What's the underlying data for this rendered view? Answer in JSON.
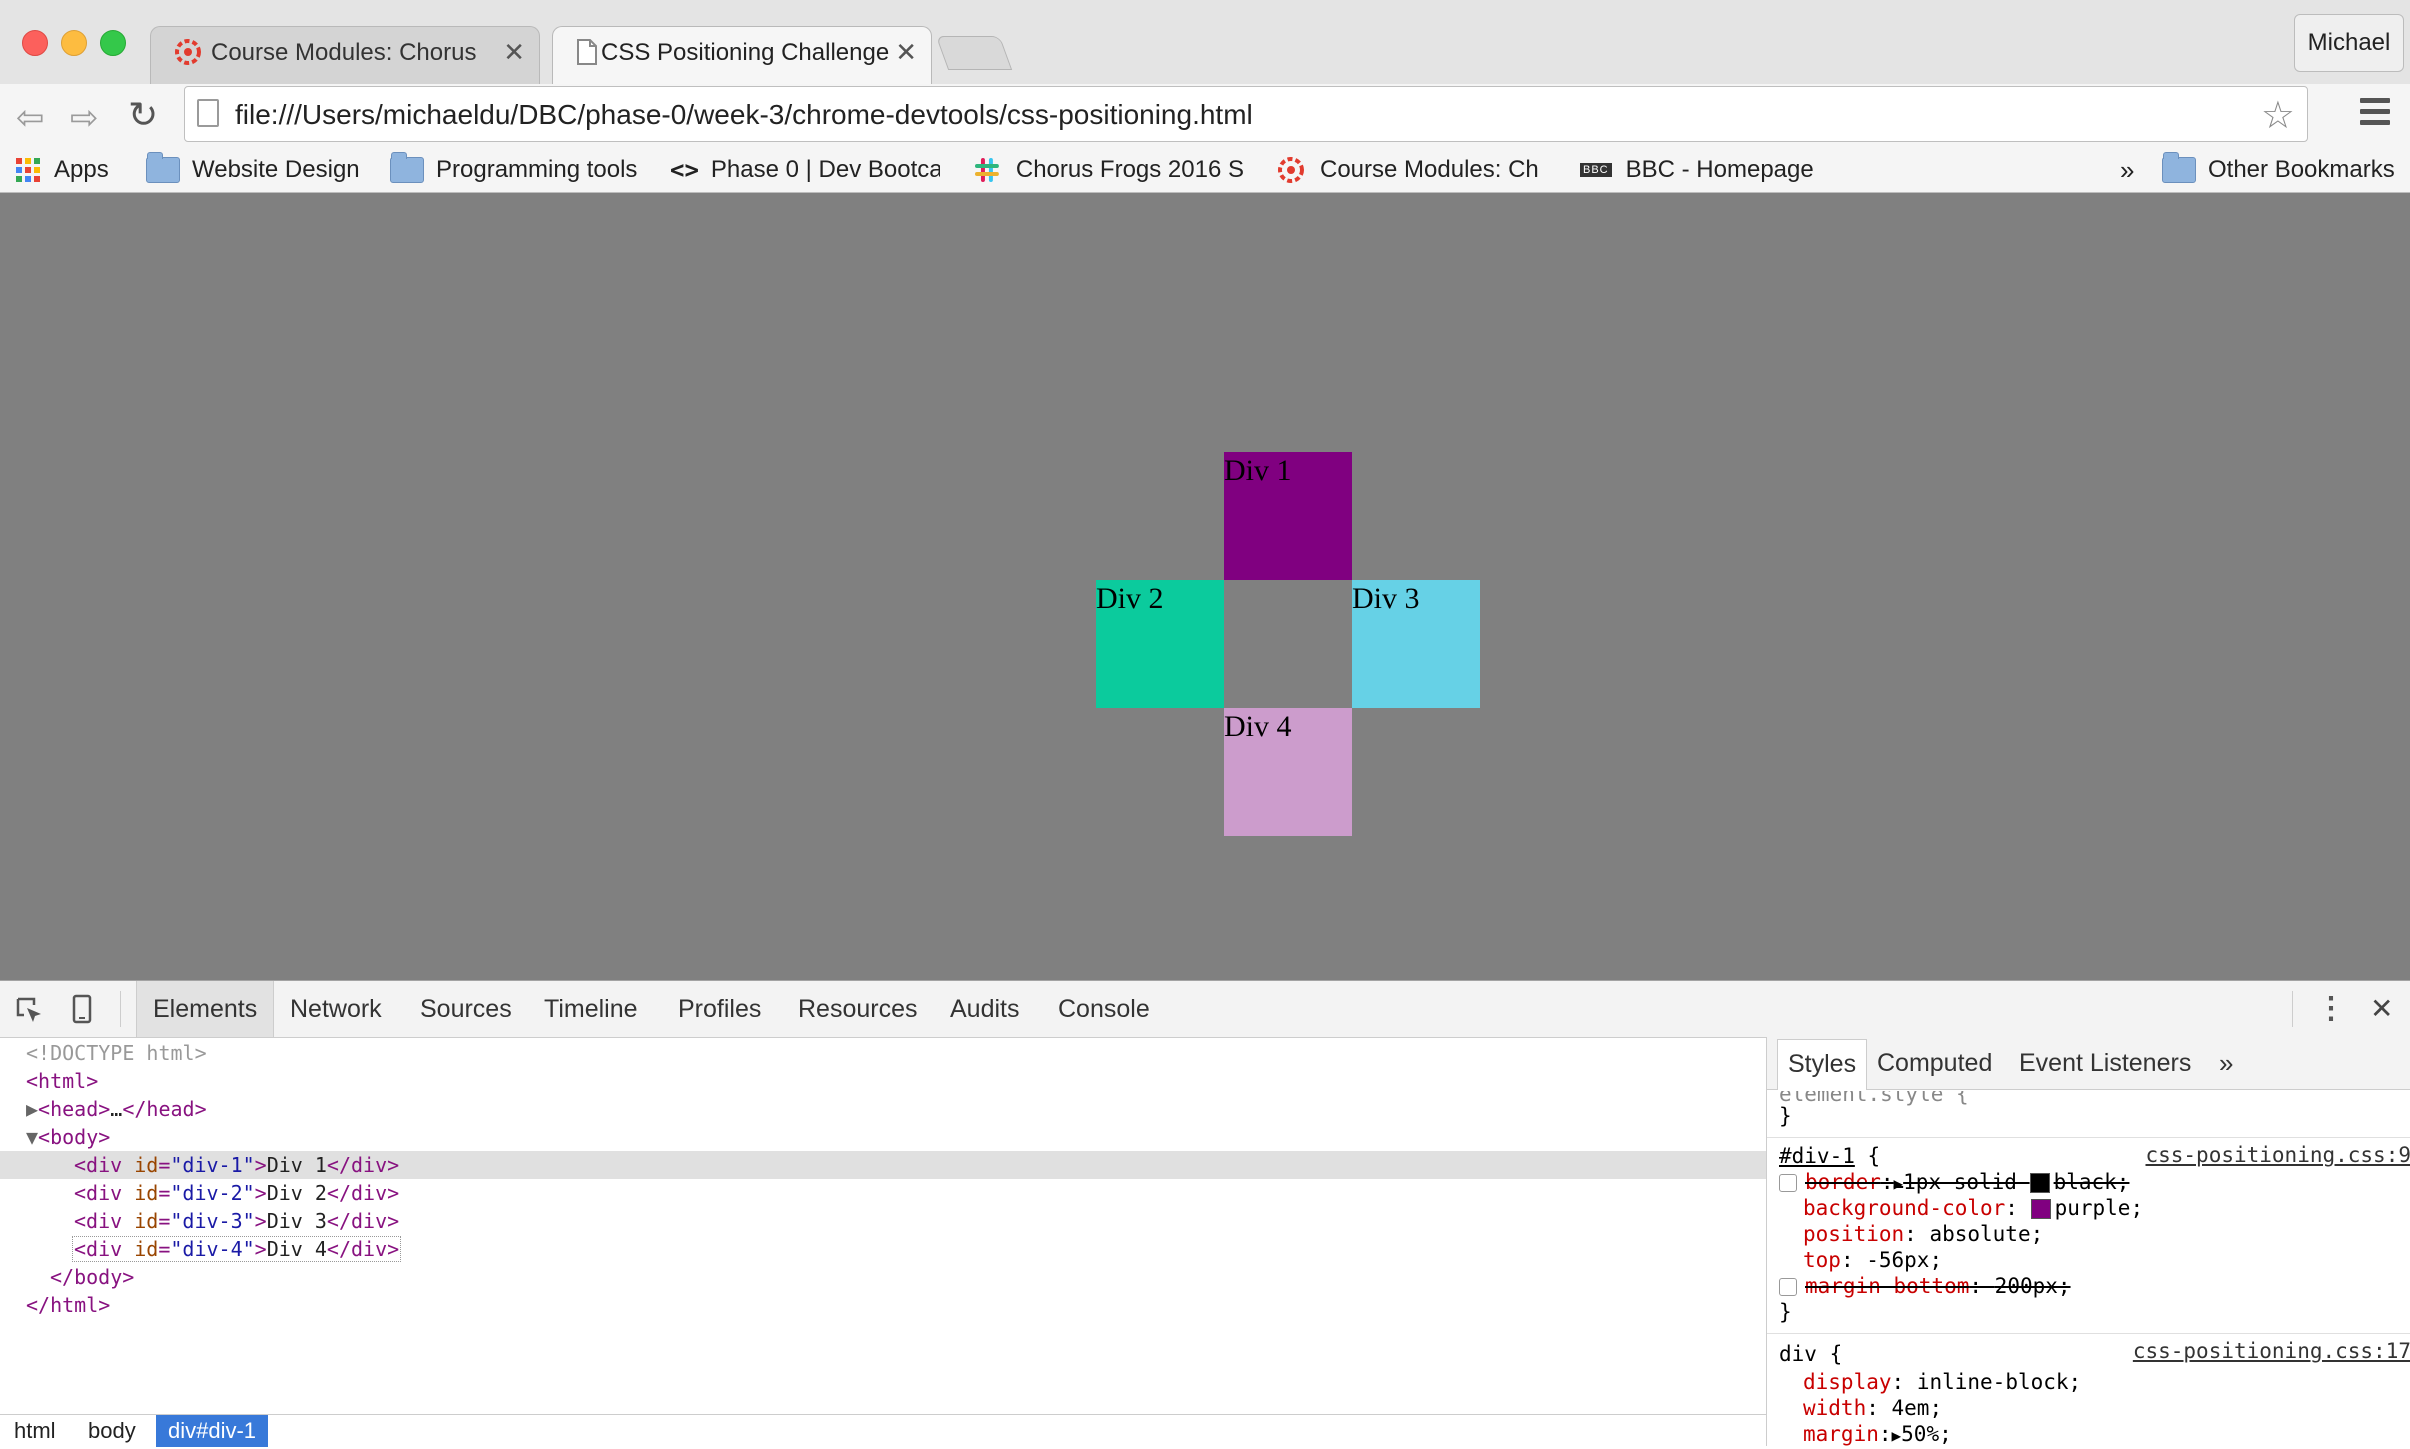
{
  "window": {
    "profile_name": "Michael",
    "tabs": [
      {
        "title": "Course Modules: Chorus F",
        "active": false,
        "favicon": "canvas-icon"
      },
      {
        "title": "CSS Positioning Challenge",
        "active": true,
        "favicon": "document-icon"
      }
    ],
    "close_glyph": "✕"
  },
  "toolbar": {
    "back_glyph": "⇦",
    "forward_glyph": "⇨",
    "reload_glyph": "↻",
    "url": "file:///Users/michaeldu/DBC/phase-0/week-3/chrome-devtools/css-positioning.html",
    "star_glyph": "☆"
  },
  "bookmarks": {
    "items": [
      {
        "label": "Apps",
        "icon": "apps-grid-icon"
      },
      {
        "label": "Website Design",
        "icon": "folder-icon"
      },
      {
        "label": "Programming tools",
        "icon": "folder-icon"
      },
      {
        "label": "Phase 0 | Dev Bootca",
        "icon": "code-icon"
      },
      {
        "label": "Chorus Frogs 2016 S",
        "icon": "slack-icon"
      },
      {
        "label": "Course Modules: Ch",
        "icon": "canvas-icon"
      },
      {
        "label": "BBC - Homepage",
        "icon": "bbc-icon"
      }
    ],
    "overflow_glyph": "»",
    "other": "Other Bookmarks",
    "code_glyph": "<>",
    "bbc_text": "BBC"
  },
  "page": {
    "background": "#808080",
    "divs": [
      {
        "id": "div-1",
        "label": "Div 1",
        "color": "#800080"
      },
      {
        "id": "div-2",
        "label": "Div 2",
        "color": "#0bcb9d"
      },
      {
        "id": "div-3",
        "label": "Div 3",
        "color": "#66d1e6"
      },
      {
        "id": "div-4",
        "label": "Div 4",
        "color": "#cc9ccc"
      }
    ]
  },
  "devtools": {
    "tabs": [
      "Elements",
      "Network",
      "Sources",
      "Timeline",
      "Profiles",
      "Resources",
      "Audits",
      "Console"
    ],
    "active_tab": "Elements",
    "more_glyph": "⋮",
    "close_glyph": "✕",
    "dom": {
      "doctype": "<!DOCTYPE html>",
      "html_open": "<html>",
      "head_open": "<head>",
      "head_ellipsis": "…",
      "head_close": "</head>",
      "body_open": "<body>",
      "div_open": "<div",
      "id_attr": "id",
      "div_close": "</div>",
      "ids": [
        "\"div-1\"",
        "\"div-2\"",
        "\"div-3\"",
        "\"div-4\""
      ],
      "texts": [
        "Div 1",
        "Div 2",
        "Div 3",
        "Div 4"
      ],
      "body_close": "</body>",
      "html_close": "</html>"
    },
    "breadcrumbs": [
      "html",
      "body",
      "div#div-1"
    ],
    "styles_tabs": [
      "Styles",
      "Computed",
      "Event Listeners"
    ],
    "styles_more": "»",
    "styles": {
      "element_style_line": "element.style {",
      "close_brace": "}",
      "rule1_selector": "#div-1",
      "rule1_source": "css-positioning.css:9",
      "rule1_props": [
        {
          "name": "border",
          "value": "1px solid ",
          "value2": "black;",
          "disabled": true,
          "swatch": "#000000"
        },
        {
          "name": "background-color",
          "value": "purple;",
          "disabled": false,
          "swatch": "#800080"
        },
        {
          "name": "position",
          "value": "absolute;",
          "disabled": false
        },
        {
          "name": "top",
          "value": "-56px;",
          "disabled": false
        },
        {
          "name": "margin-bottom",
          "value": "200px;",
          "disabled": true
        }
      ],
      "rule2_selector": "div",
      "rule2_source": "css-positioning.css:17",
      "rule2_props": [
        {
          "name": "display",
          "value": "inline-block;"
        },
        {
          "name": "width",
          "value": "4em;"
        },
        {
          "name": "margin",
          "value": "50%;"
        }
      ]
    }
  }
}
